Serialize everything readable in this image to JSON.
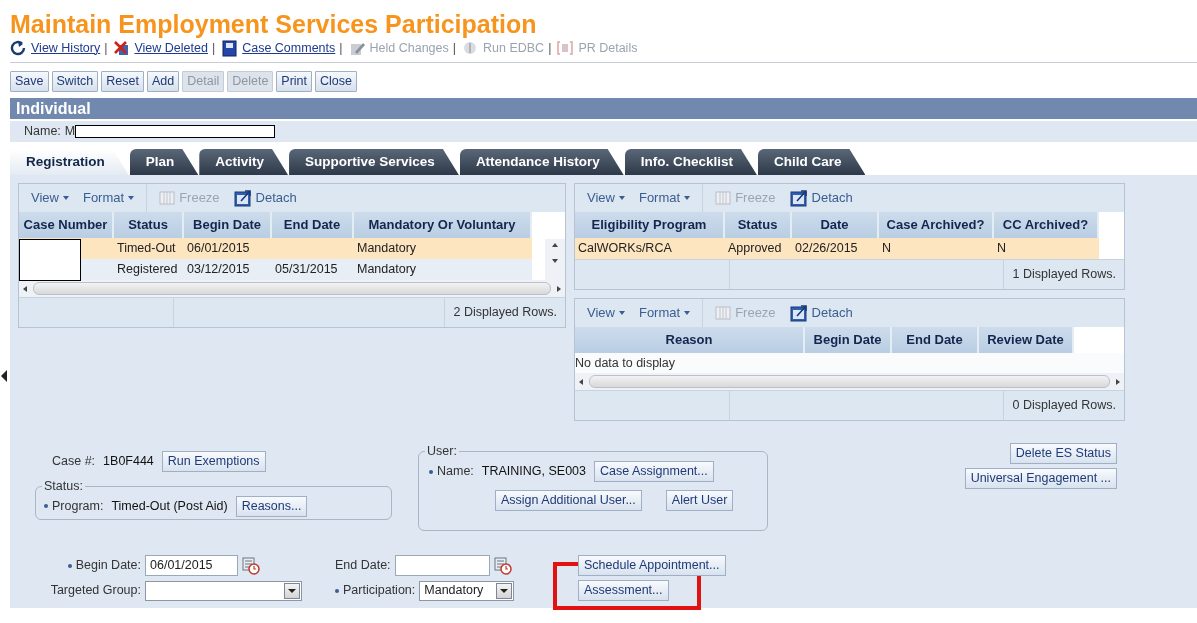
{
  "page": {
    "title": "Maintain Employment Services Participation"
  },
  "links": [
    {
      "kind": "history",
      "label": "View History",
      "disabled": false
    },
    {
      "separator": "|",
      "kind": "deleted",
      "label": "View Deleted",
      "disabled": false
    },
    {
      "separator": "|",
      "kind": "comments",
      "label": "Case Comments",
      "disabled": false
    },
    {
      "separator": "|",
      "kind": "held",
      "label": "Held Changes",
      "disabled": true
    },
    {
      "separator": "|",
      "kind": "edbc",
      "label": "Run EDBC",
      "disabled": true
    },
    {
      "separator": "|",
      "kind": "pr",
      "label": "PR Details",
      "disabled": true
    }
  ],
  "toolbar": [
    {
      "label": "Save",
      "disabled": false
    },
    {
      "label": "Switch",
      "disabled": false
    },
    {
      "label": "Reset",
      "disabled": false
    },
    {
      "label": "Add",
      "disabled": false
    },
    {
      "label": "Detail",
      "disabled": true
    },
    {
      "label": "Delete",
      "disabled": true
    },
    {
      "label": "Print",
      "disabled": false
    },
    {
      "label": "Close",
      "disabled": false
    }
  ],
  "section": {
    "title": "Individual",
    "name_label": "Name:",
    "name_value": "M",
    "name_redacted": true
  },
  "tabs": [
    {
      "label": "Registration",
      "selected": true
    },
    {
      "label": "Plan",
      "selected": false
    },
    {
      "label": "Activity",
      "selected": false
    },
    {
      "label": "Supportive Services",
      "selected": false
    },
    {
      "label": "Attendance History",
      "selected": false
    },
    {
      "label": "Info. Checklist",
      "selected": false
    },
    {
      "label": "Child Care",
      "selected": false
    }
  ],
  "tables": [
    {
      "tools": {
        "view": "View",
        "format": "Format",
        "freeze": "Freeze",
        "detach": "Detach",
        "freeze_disabled": true
      },
      "columns": [
        {
          "label": "Case Number",
          "redacted": true
        },
        {
          "label": "Status"
        },
        {
          "label": "Begin Date"
        },
        {
          "label": "End Date"
        },
        {
          "label": "Mandatory Or Voluntary"
        }
      ],
      "rows": [
        {
          "selected": true,
          "cells": [
            null,
            "Timed-Out",
            "06/01/2015",
            null,
            "Mandatory"
          ]
        },
        {
          "selected": false,
          "cells": [
            null,
            "Registered",
            "03/12/2015",
            "05/31/2015",
            "Mandatory"
          ]
        }
      ],
      "vertical_scroll": true,
      "horizontal_scroll": true,
      "footer": "2 Displayed Rows."
    },
    {
      "tools": {
        "view": "View",
        "format": "Format",
        "freeze": "Freeze",
        "detach": "Detach",
        "freeze_disabled": true
      },
      "columns": [
        {
          "label": "Eligibility Program"
        },
        {
          "label": "Status"
        },
        {
          "label": "Date"
        },
        {
          "label": "Case Archived?"
        },
        {
          "label": "CC Archived?"
        }
      ],
      "rows": [
        {
          "selected": true,
          "cells": [
            "CalWORKs/RCA",
            "Approved",
            "02/26/2015",
            "N",
            "N"
          ]
        }
      ],
      "footer": "1 Displayed Rows."
    },
    {
      "tools": {
        "view": "View",
        "format": "Format",
        "freeze": "Freeze",
        "detach": "Detach",
        "freeze_disabled": true
      },
      "columns": [
        {
          "label": "Reason"
        },
        {
          "label": "Begin Date"
        },
        {
          "label": "End Date"
        },
        {
          "label": "Review Date"
        }
      ],
      "empty_text": "No data to display",
      "horizontal_scroll": true,
      "footer": "0 Displayed Rows."
    }
  ],
  "case": {
    "label": "Case #:",
    "value": "1B0F444",
    "button": "Run Exemptions"
  },
  "status_group": {
    "legend": "Status:",
    "label": "Program:",
    "required": true,
    "value": "Timed-Out (Post Aid)",
    "button": "Reasons..."
  },
  "user_group": {
    "legend": "User:",
    "label": "Name:",
    "required": true,
    "value": "TRAINING, SE003",
    "buttons": [
      "Case Assignment...",
      "Assign Additional User...",
      "Alert User"
    ]
  },
  "side_buttons": [
    "Delete ES Status",
    "Universal Engagement ..."
  ],
  "fields": [
    {
      "kind": "date",
      "label": "Begin Date:",
      "required": true,
      "value": "06/01/2015"
    },
    {
      "kind": "date",
      "label": "End Date:",
      "required": false
    },
    {
      "kind": "select",
      "label": "Targeted Group:",
      "required": false
    },
    {
      "kind": "select",
      "label": "Participation:",
      "required": true,
      "value": "Mandatory"
    }
  ],
  "action_buttons": [
    {
      "label": "Schedule Appointment...",
      "highlighted": false
    },
    {
      "label": "Assessment...",
      "highlighted": true
    }
  ]
}
